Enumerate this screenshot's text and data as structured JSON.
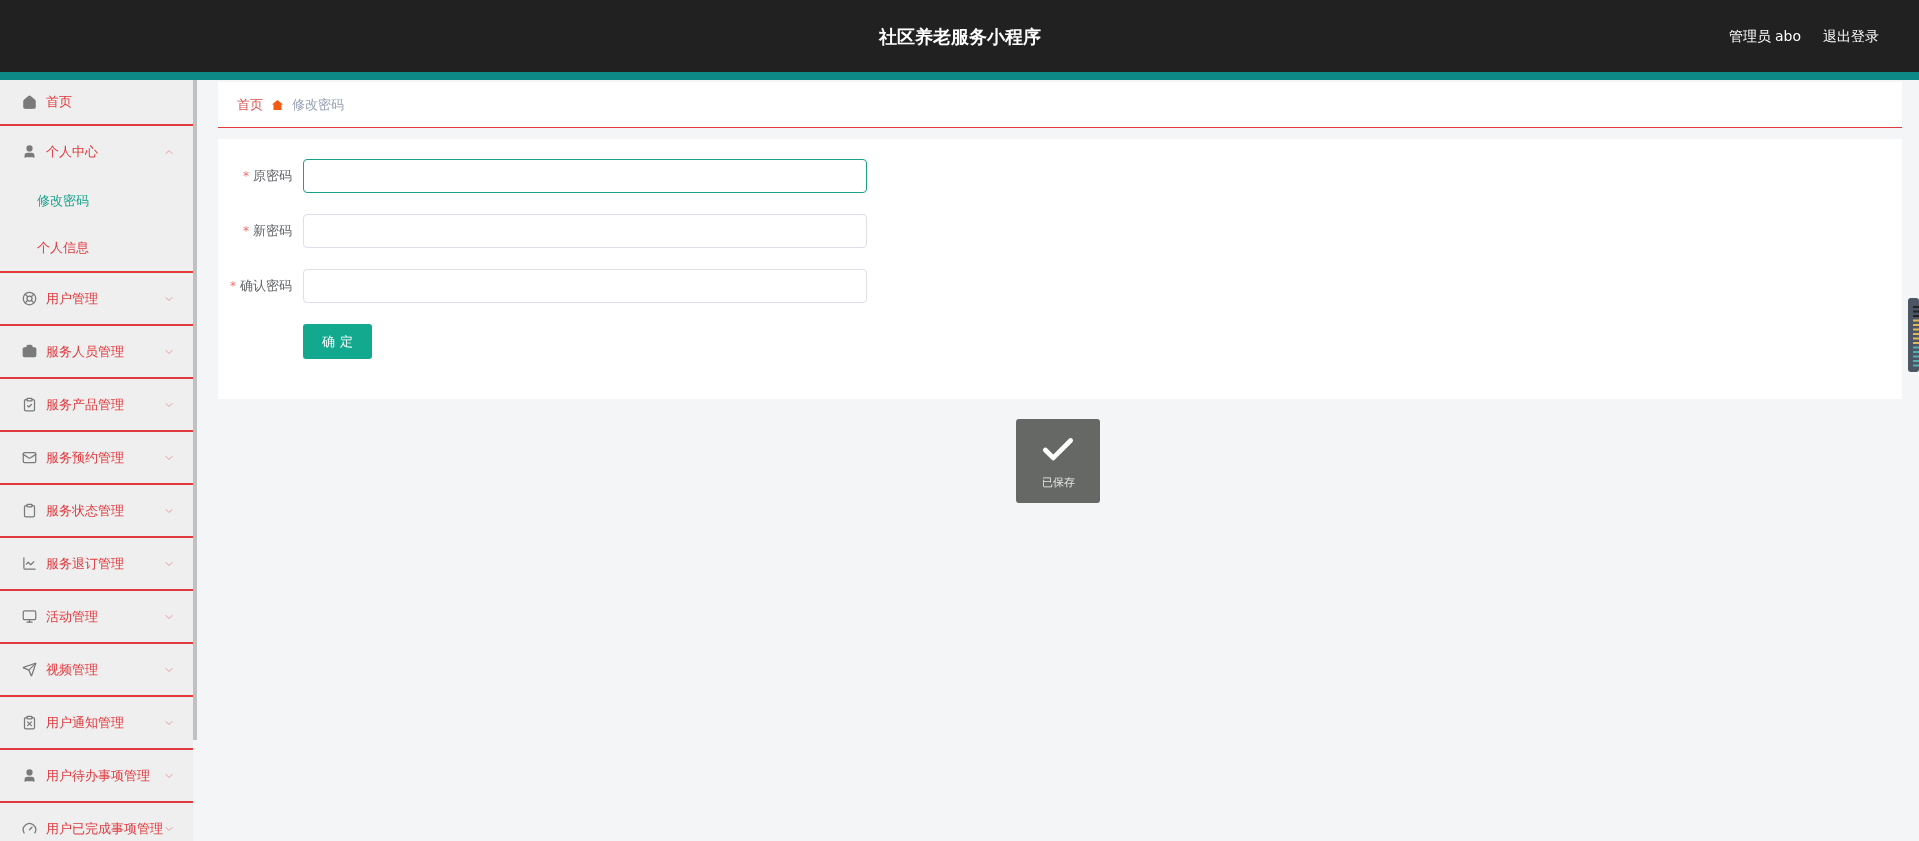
{
  "header": {
    "title": "社区养老服务小程序",
    "user": "管理员 abo",
    "logout": "退出登录"
  },
  "sidebar": {
    "items": [
      {
        "label": "首页",
        "kind": "link"
      },
      {
        "label": "个人中心",
        "kind": "group",
        "expanded": true,
        "children": [
          {
            "label": "修改密码",
            "selected": true
          },
          {
            "label": "个人信息",
            "selected": false
          }
        ]
      },
      {
        "label": "用户管理",
        "kind": "group",
        "expanded": false
      },
      {
        "label": "服务人员管理",
        "kind": "group",
        "expanded": false
      },
      {
        "label": "服务产品管理",
        "kind": "group",
        "expanded": false
      },
      {
        "label": "服务预约管理",
        "kind": "group",
        "expanded": false
      },
      {
        "label": "服务状态管理",
        "kind": "group",
        "expanded": false
      },
      {
        "label": "服务退订管理",
        "kind": "group",
        "expanded": false
      },
      {
        "label": "活动管理",
        "kind": "group",
        "expanded": false
      },
      {
        "label": "视频管理",
        "kind": "group",
        "expanded": false
      },
      {
        "label": "用户通知管理",
        "kind": "group",
        "expanded": false
      },
      {
        "label": "用户待办事项管理",
        "kind": "group",
        "expanded": false
      },
      {
        "label": "用户已完成事项管理",
        "kind": "group",
        "expanded": false
      }
    ]
  },
  "breadcrumb": [
    "首页",
    "修改密码"
  ],
  "form": {
    "fields": [
      {
        "marker": "*",
        "label": "原密码",
        "focused": true
      },
      {
        "marker": "*",
        "label": "新密码",
        "focused": false
      },
      {
        "marker": "*",
        "label": "确认密码",
        "focused": false
      }
    ],
    "submit": "确 定"
  },
  "toast": {
    "text": "已保存"
  }
}
